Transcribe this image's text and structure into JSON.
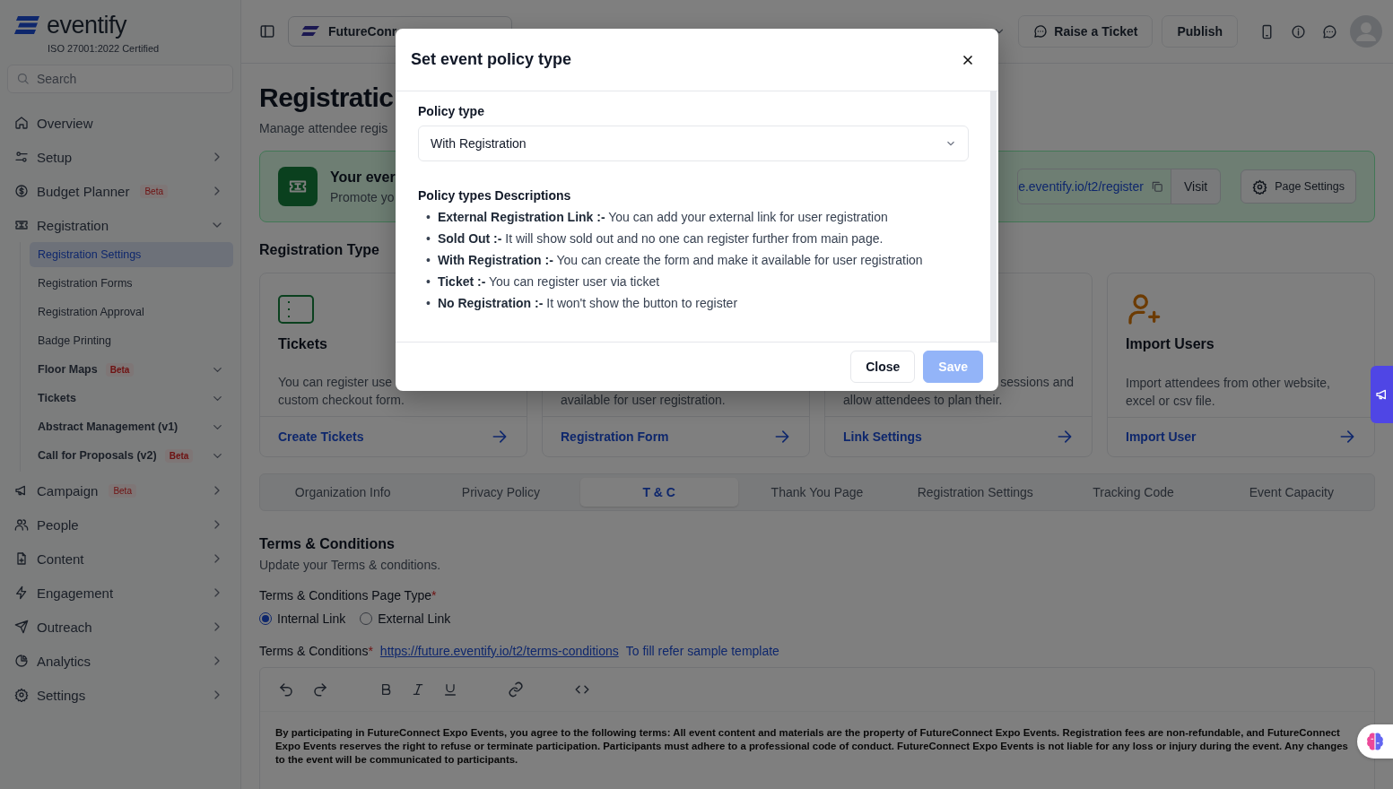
{
  "sidebar": {
    "logo": "eventify",
    "certification": "ISO 27001:2022 Certified",
    "search": {
      "placeholder": "Search"
    },
    "items": [
      {
        "label": "Overview",
        "selected": false
      },
      {
        "label": "Setup",
        "selected": false,
        "expanded": false
      },
      {
        "label": "Budget Planner",
        "badge": "Beta",
        "selected": false,
        "expanded": false
      },
      {
        "label": "Registration",
        "selected": false,
        "expanded": true,
        "children": [
          {
            "label": "Registration Settings",
            "selected": true
          },
          {
            "label": "Registration Forms",
            "selected": false
          },
          {
            "label": "Registration Approval",
            "selected": false
          },
          {
            "label": "Badge Printing",
            "selected": false
          },
          {
            "label": "Floor Maps",
            "badge": "Beta",
            "selected": false,
            "expanded": false
          },
          {
            "label": "Tickets",
            "selected": false,
            "expanded": false
          },
          {
            "label": "Abstract Management (v1)",
            "selected": false,
            "expanded": false
          },
          {
            "label": "Call for Proposals (v2)",
            "badge": "Beta",
            "selected": false,
            "expanded": false
          }
        ]
      },
      {
        "label": "Campaign",
        "badge": "Beta",
        "selected": false,
        "expanded": false
      },
      {
        "label": "People",
        "selected": false,
        "expanded": false
      },
      {
        "label": "Content",
        "selected": false,
        "expanded": false
      },
      {
        "label": "Engagement",
        "selected": false,
        "expanded": false
      },
      {
        "label": "Outreach",
        "selected": false,
        "expanded": false
      },
      {
        "label": "Analytics",
        "selected": false,
        "expanded": false
      },
      {
        "label": "Settings",
        "selected": false,
        "expanded": false
      }
    ]
  },
  "topbar": {
    "event_selector": "FutureConr",
    "buttons": [
      "Raise a Ticket",
      "Publish"
    ]
  },
  "page": {
    "title": "Registratic",
    "subtitle": "Manage attendee regis",
    "banner": {
      "title": "Your ever",
      "subtitle": "Promote yo",
      "link": "e.eventify.io/t2/register",
      "visit": "Visit",
      "settings": "Page Settings"
    },
    "section_title": "Registration Type",
    "cards": [
      {
        "title": "Tickets",
        "description": [
          "You can register use",
          "custom checkout form."
        ],
        "action": "Create Tickets"
      },
      {
        "description": [
          "available for user registration."
        ],
        "action": "Registration Form"
      },
      {
        "description": [
          "sessions and",
          "allow attendees to plan their."
        ],
        "action": "Link Settings"
      },
      {
        "title": "Import Users",
        "description": [
          "Import attendees from other website,",
          "excel or csv file."
        ],
        "action": "Import User"
      }
    ],
    "tabs": [
      {
        "label": "Organization Info",
        "selected": false
      },
      {
        "label": "Privacy Policy",
        "selected": false
      },
      {
        "label": "T & C",
        "selected": true
      },
      {
        "label": "Thank You Page",
        "selected": false
      },
      {
        "label": "Registration Settings",
        "selected": false
      },
      {
        "label": "Tracking Code",
        "selected": false
      },
      {
        "label": "Event Capacity",
        "selected": false
      }
    ],
    "terms": {
      "title": "Terms & Conditions",
      "subtitle": "Update your Terms & conditions.",
      "page_type_label": "Terms & Conditions Page Type",
      "page_type_required": "*",
      "page_type_options": [
        {
          "label": "Internal Link",
          "selected": true
        },
        {
          "label": "External Link",
          "selected": false
        }
      ],
      "content_label": "Terms & Conditions",
      "content_required": "*",
      "url": "https://future.eventify.io/t2/terms-conditions",
      "template_link": "To fill refer sample template",
      "content": "By participating in FutureConnect Expo Events, you agree to the following terms: All event content and materials are the property of FutureConnect Expo Events. Registration fees are non-refundable, and FutureConnect Expo Events reserves the right to refuse or terminate participation. Participants must adhere to a professional code of conduct. FutureConnect Expo Events is not liable for any loss or injury during the event. Any changes to the event will be communicated to participants."
    }
  },
  "modal": {
    "title": "Set event policy type",
    "field_label": "Policy type",
    "field_value": "With Registration",
    "descriptions_title": "Policy types Descriptions",
    "descriptions": [
      {
        "marker": "•",
        "text": "**External Registration Link :-** You can add your external link for user registration"
      },
      {
        "marker": "•",
        "text": "**Sold Out :-** It will show sold out and no one can register further from main page."
      },
      {
        "marker": "•",
        "text": "**With Registration :-** You can create the form and make it available for user registration"
      },
      {
        "marker": "•",
        "text": "**Ticket :-** You can register user via ticket"
      },
      {
        "marker": "•",
        "text": "**No Registration :-** It won't show the button to register"
      }
    ],
    "buttons": [
      {
        "label": "Close",
        "kind": "secondary",
        "disabled": false
      },
      {
        "label": "Save",
        "kind": "primary",
        "disabled": true
      }
    ]
  }
}
